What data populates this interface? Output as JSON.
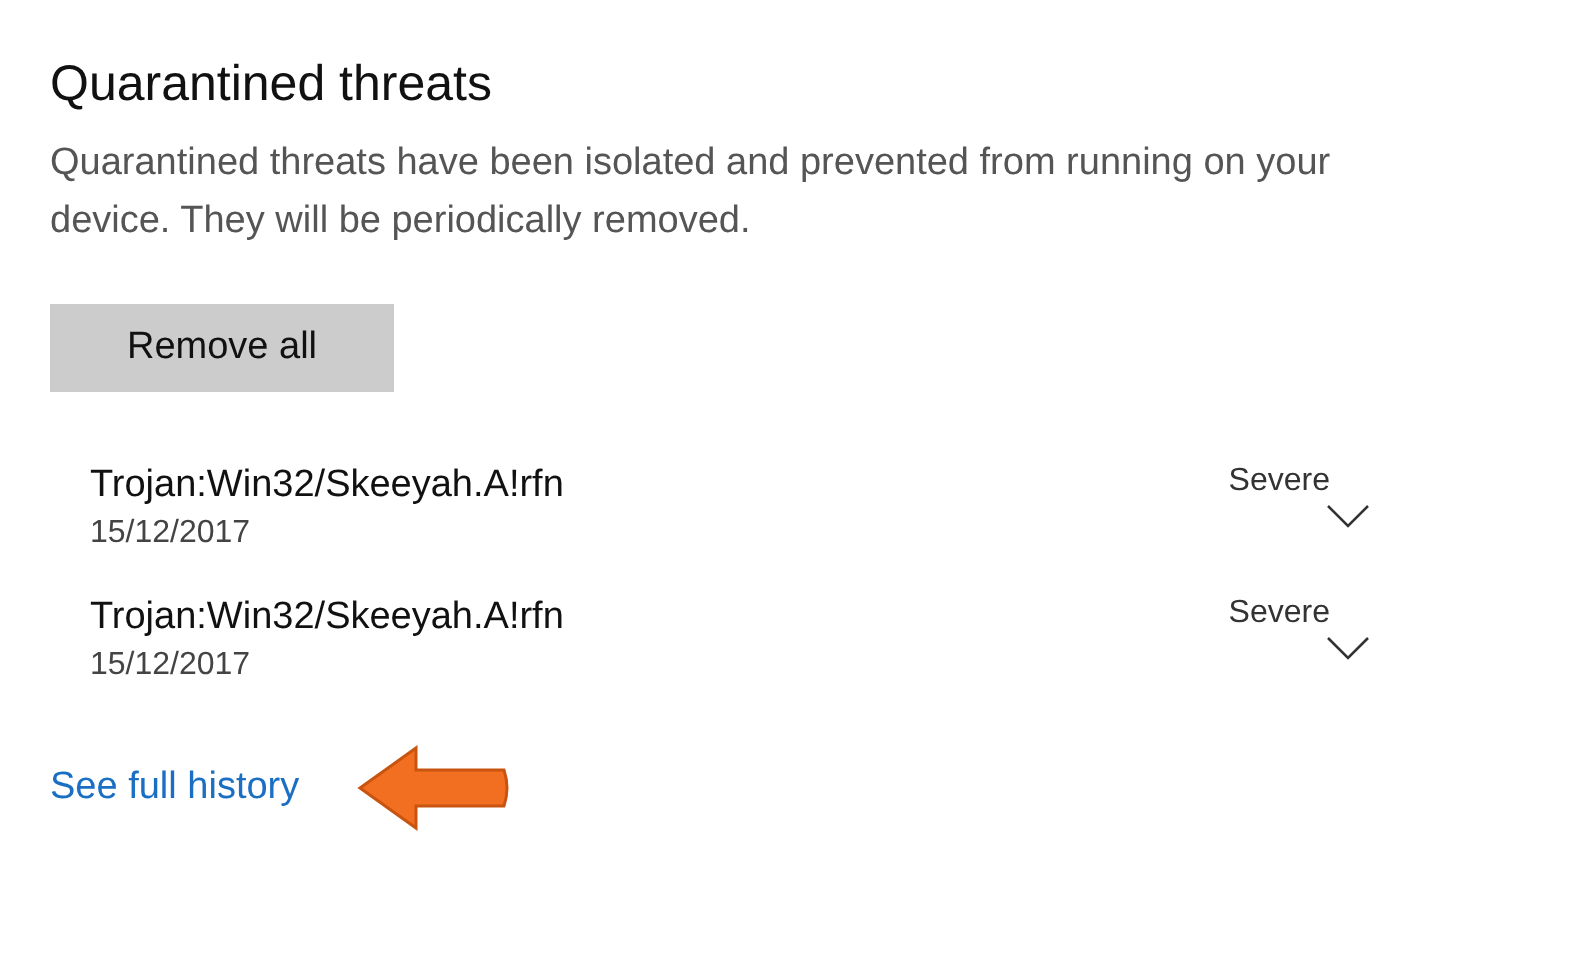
{
  "title": "Quarantined threats",
  "description": "Quarantined threats have been isolated and prevented from running on your device.  They will be periodically removed.",
  "remove_button": "Remove all",
  "threats": [
    {
      "name": "Trojan:Win32/Skeeyah.A!rfn",
      "date": "15/12/2017",
      "severity": "Severe",
      "expanded": false
    },
    {
      "name": "Trojan:Win32/Skeeyah.A!rfn",
      "date": "15/12/2017",
      "severity": "Severe",
      "expanded": false
    }
  ],
  "history_link": "See full history"
}
